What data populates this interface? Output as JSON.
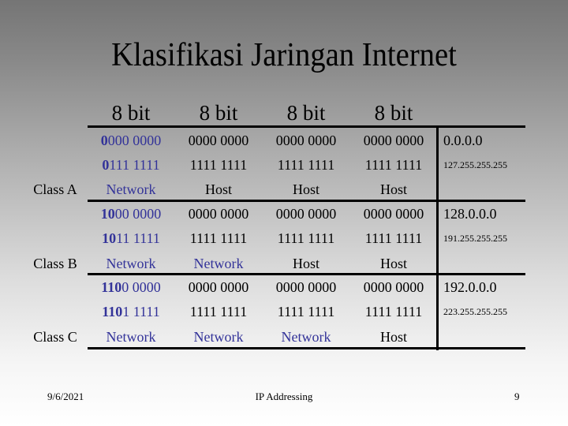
{
  "title": "Klasifikasi Jaringan Internet",
  "headers": [
    "8 bit",
    "8 bit",
    "8 bit",
    "8 bit"
  ],
  "classes": [
    {
      "label": "Class A",
      "first_octet_start": {
        "bold": "0",
        "rest": "000 0000"
      },
      "first_octet_end": {
        "bold": "0",
        "rest": "111 1111"
      },
      "start_octets": [
        "0000 0000",
        "0000 0000",
        "0000 0000"
      ],
      "end_octets": [
        "1111 1111",
        "1111 1111",
        "1111 1111"
      ],
      "roles": [
        "Network",
        "Host",
        "Host",
        "Host"
      ],
      "range_start": "0.0.0.0",
      "range_end": "127.255.255.255"
    },
    {
      "label": "Class B",
      "first_octet_start": {
        "bold": "10",
        "rest": "00 0000"
      },
      "first_octet_end": {
        "bold": "10",
        "rest": "11 1111"
      },
      "start_octets": [
        "0000 0000",
        "0000 0000",
        "0000 0000"
      ],
      "end_octets": [
        "1111 1111",
        "1111 1111",
        "1111 1111"
      ],
      "roles": [
        "Network",
        "Network",
        "Host",
        "Host"
      ],
      "range_start": "128.0.0.0",
      "range_end": "191.255.255.255"
    },
    {
      "label": "Class C",
      "first_octet_start": {
        "bold": "110",
        "rest": "0 0000"
      },
      "first_octet_end": {
        "bold": "110",
        "rest": "1 1111"
      },
      "start_octets": [
        "0000 0000",
        "0000 0000",
        "0000 0000"
      ],
      "end_octets": [
        "1111 1111",
        "1111 1111",
        "1111 1111"
      ],
      "roles": [
        "Network",
        "Network",
        "Network",
        "Host"
      ],
      "range_start": "192.0.0.0",
      "range_end": "223.255.255.255"
    }
  ],
  "footer": {
    "date": "9/6/2021",
    "center": "IP Addressing",
    "page": "9"
  },
  "colors": {
    "network_text": "#333399",
    "line": "#000000"
  }
}
